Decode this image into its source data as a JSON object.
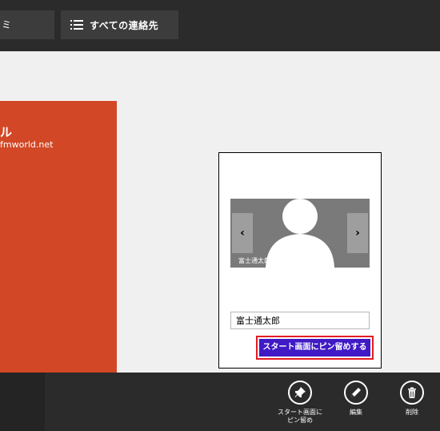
{
  "header": {
    "left_tile_text": "ミ",
    "contacts_tile_icon": "list-icon",
    "contacts_tile_label": "すべての連絡先"
  },
  "contact_tile": {
    "name_fragment": "ル",
    "email_fragment": "fmworld.net",
    "color": "#d24726"
  },
  "pin_dialog": {
    "preview_icon": "person-silhouette-icon",
    "prev_arrow": "‹",
    "next_arrow": "›",
    "preview_caption": "富士通太郎",
    "name_value": "富士通太郎",
    "pin_button_label": "スタート画面にピン留めする",
    "button_color": "#3f1ac5",
    "highlight_color": "#e31b23"
  },
  "app_bar": {
    "commands": [
      {
        "icon": "pin-icon",
        "label": "スタート画面に\nピン留め"
      },
      {
        "icon": "pencil-icon",
        "label": "編集"
      },
      {
        "icon": "trash-icon",
        "label": "削除"
      }
    ]
  }
}
